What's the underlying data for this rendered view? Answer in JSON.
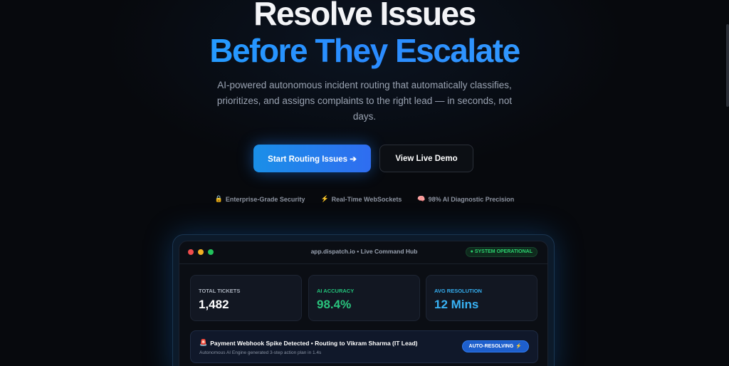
{
  "hero": {
    "title_line1": "Resolve Issues",
    "title_line2": "Before They Escalate",
    "subtitle": "AI-powered autonomous incident routing that automatically classifies, prioritizes, and assigns complaints to the right lead — in seconds, not days.",
    "primary_cta": "Start Routing Issues ➔",
    "secondary_cta": "View Live Demo"
  },
  "features": [
    {
      "icon": "lock-icon",
      "glyph": "🔒",
      "label": "Enterprise-Grade Security"
    },
    {
      "icon": "lightning-icon",
      "glyph": "⚡",
      "label": "Real-Time WebSockets"
    },
    {
      "icon": "brain-icon",
      "glyph": "🧠",
      "label": "98% AI Diagnostic Precision"
    }
  ],
  "dashboard": {
    "url": "app.dispatch.io • Live Command Hub",
    "status": "● SYSTEM OPERATIONAL",
    "stats": [
      {
        "label": "TOTAL TICKETS",
        "value": "1,482"
      },
      {
        "label": "AI ACCURACY",
        "value": "98.4%"
      },
      {
        "label": "AVG RESOLUTION",
        "value": "12 Mins"
      }
    ],
    "alert": {
      "icon": "siren-icon",
      "glyph": "🚨",
      "title": "Payment Webhook Spike Detected • Routing to Vikram Sharma (IT Lead)",
      "subtitle": "Autonomous AI Engine generated 3-step action plan in 1.4s",
      "badge": "AUTO-RESOLVING",
      "badge_icon": "lightning-icon",
      "badge_glyph": "⚡"
    }
  },
  "colors": {
    "background": "#07090d",
    "accent_blue": "#1ea7ff",
    "success_green": "#29c47d",
    "resolution_blue": "#38b2f5"
  }
}
